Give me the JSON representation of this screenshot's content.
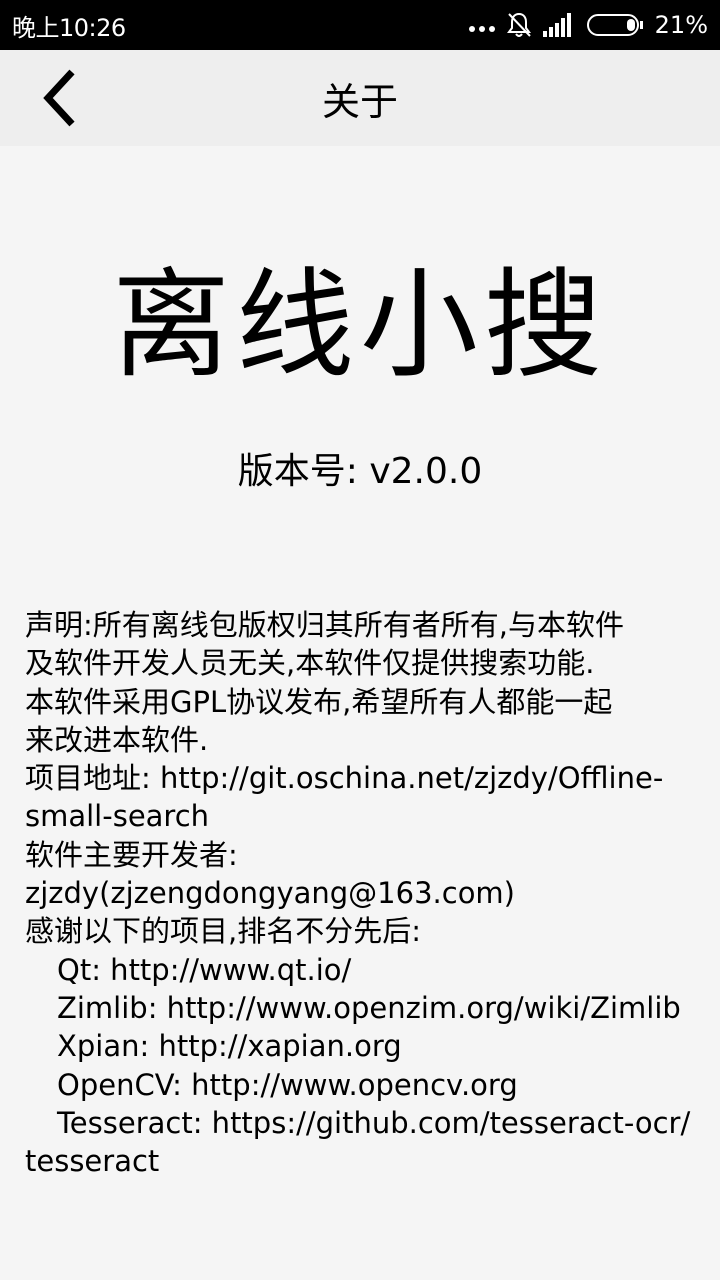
{
  "status_bar": {
    "time": "晚上10:26",
    "battery_percent": "21%",
    "icons": [
      "more-dots-icon",
      "bell-off-icon",
      "signal-icon",
      "battery-icon"
    ]
  },
  "header": {
    "title": "关于",
    "back_icon": "back-chevron-icon"
  },
  "main": {
    "app_name": "离线小搜",
    "version_label": "版本号: v2.0.0",
    "info_lines": [
      "声明:所有离线包版权归其所有者所有,与本软件",
      "及软件开发人员无关,本软件仅提供搜索功能.",
      "本软件采用GPL协议发布,希望所有人都能一起",
      "来改进本软件.",
      "项目地址: http://git.oschina.net/zjzdy/Offline-",
      "small-search",
      "软件主要开发者:",
      "zjzdy(zjzengdongyang@163.com)",
      "感谢以下的项目,排名不分先后:",
      "Qt: http://www.qt.io/",
      "Zimlib: http://www.openzim.org/wiki/Zimlib",
      "Xpian: http://xapian.org",
      "OpenCV: http://www.opencv.org",
      "Tesseract: https://github.com/tesseract-ocr/",
      "tesseract"
    ]
  },
  "colors": {
    "status_bar_bg": "#000000",
    "title_bar_bg": "#eeeeee",
    "page_bg": "#f5f5f5",
    "text": "#000000"
  }
}
